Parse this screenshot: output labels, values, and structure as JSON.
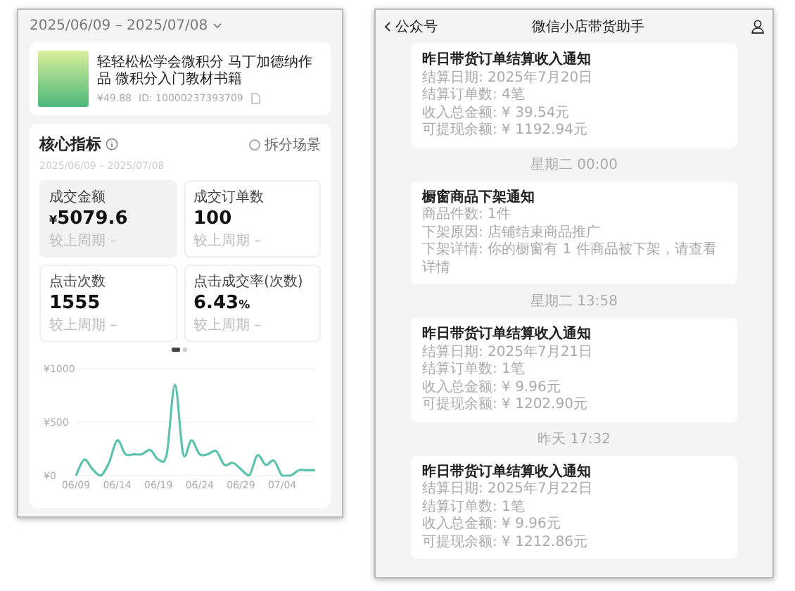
{
  "left_screen": {
    "date_range": "2025/06/09 – 2025/07/08",
    "product": {
      "title": "轻轻松松学会微积分 马丁加德纳作品 微积分入门教材书籍",
      "price": "¥49.88",
      "id": "ID: 10000237393709"
    },
    "core_metrics": {
      "title": "核心指标",
      "split_scene": {
        "label": "拆分场景",
        "checked": false
      },
      "date_range": "2025/06/09 – 2025/07/08",
      "tiles": [
        {
          "label": "成交金额",
          "prefix": "¥",
          "value": "5079.6",
          "compare": "较上周期 –",
          "selected": true
        },
        {
          "label": "成交订单数",
          "value": "100",
          "compare": "较上周期 –",
          "selected": false
        },
        {
          "label": "点击次数",
          "value": "1555",
          "compare": "较上周期 –",
          "selected": false
        },
        {
          "label": "点击成交率(次数)",
          "value": "6.43",
          "suffix": "%",
          "compare": "较上周期 –",
          "selected": false
        }
      ],
      "chart_data": {
        "type": "line",
        "ylim": [
          0,
          1000
        ],
        "yticks": [
          {
            "value": 0,
            "label": "¥0"
          },
          {
            "value": 500,
            "label": "¥500"
          },
          {
            "value": 1000,
            "label": "¥1000"
          }
        ],
        "categories": [
          "06/09",
          null,
          null,
          null,
          null,
          "06/14",
          null,
          null,
          null,
          null,
          "06/19",
          null,
          null,
          null,
          null,
          "06/24",
          null,
          null,
          null,
          null,
          "06/29",
          null,
          null,
          null,
          null,
          "07/04",
          null,
          null,
          null,
          null
        ],
        "series": [
          {
            "color": "#5cc2ad",
            "values": [
              0,
              150,
              60,
              0,
              120,
              330,
              200,
              200,
              200,
              240,
              150,
              200,
              850,
              200,
              330,
              200,
              200,
              230,
              100,
              120,
              60,
              0,
              190,
              100,
              140,
              0,
              0,
              50,
              50,
              50
            ]
          }
        ]
      }
    }
  },
  "right_screen": {
    "back_label": "公众号",
    "title": "微信小店带货助手",
    "feed": [
      {
        "kind": "card",
        "title": "昨日带货订单结算收入通知",
        "lines": [
          "结算日期: 2025年7月20日",
          "结算订单数: 4笔",
          "收入总金额: ¥ 39.54元",
          "可提现余额: ¥ 1192.94元"
        ]
      },
      {
        "kind": "time",
        "text": "星期二 00:00"
      },
      {
        "kind": "card",
        "title": "橱窗商品下架通知",
        "lines": [
          "商品件数: 1件",
          "下架原因: 店铺结束商品推广",
          "下架详情: 你的橱窗有 1 件商品被下架，请查看详情"
        ]
      },
      {
        "kind": "time",
        "text": "星期二 13:58"
      },
      {
        "kind": "card",
        "title": "昨日带货订单结算收入通知",
        "lines": [
          "结算日期: 2025年7月21日",
          "结算订单数: 1笔",
          "收入总金额: ¥ 9.96元",
          "可提现余额: ¥ 1202.90元"
        ]
      },
      {
        "kind": "time",
        "text": "昨天 17:32"
      },
      {
        "kind": "card",
        "title": "昨日带货订单结算收入通知",
        "lines": [
          "结算日期: 2025年7月22日",
          "结算订单数: 1笔",
          "收入总金额: ¥ 9.96元",
          "可提现余额: ¥ 1212.86元"
        ]
      }
    ]
  }
}
